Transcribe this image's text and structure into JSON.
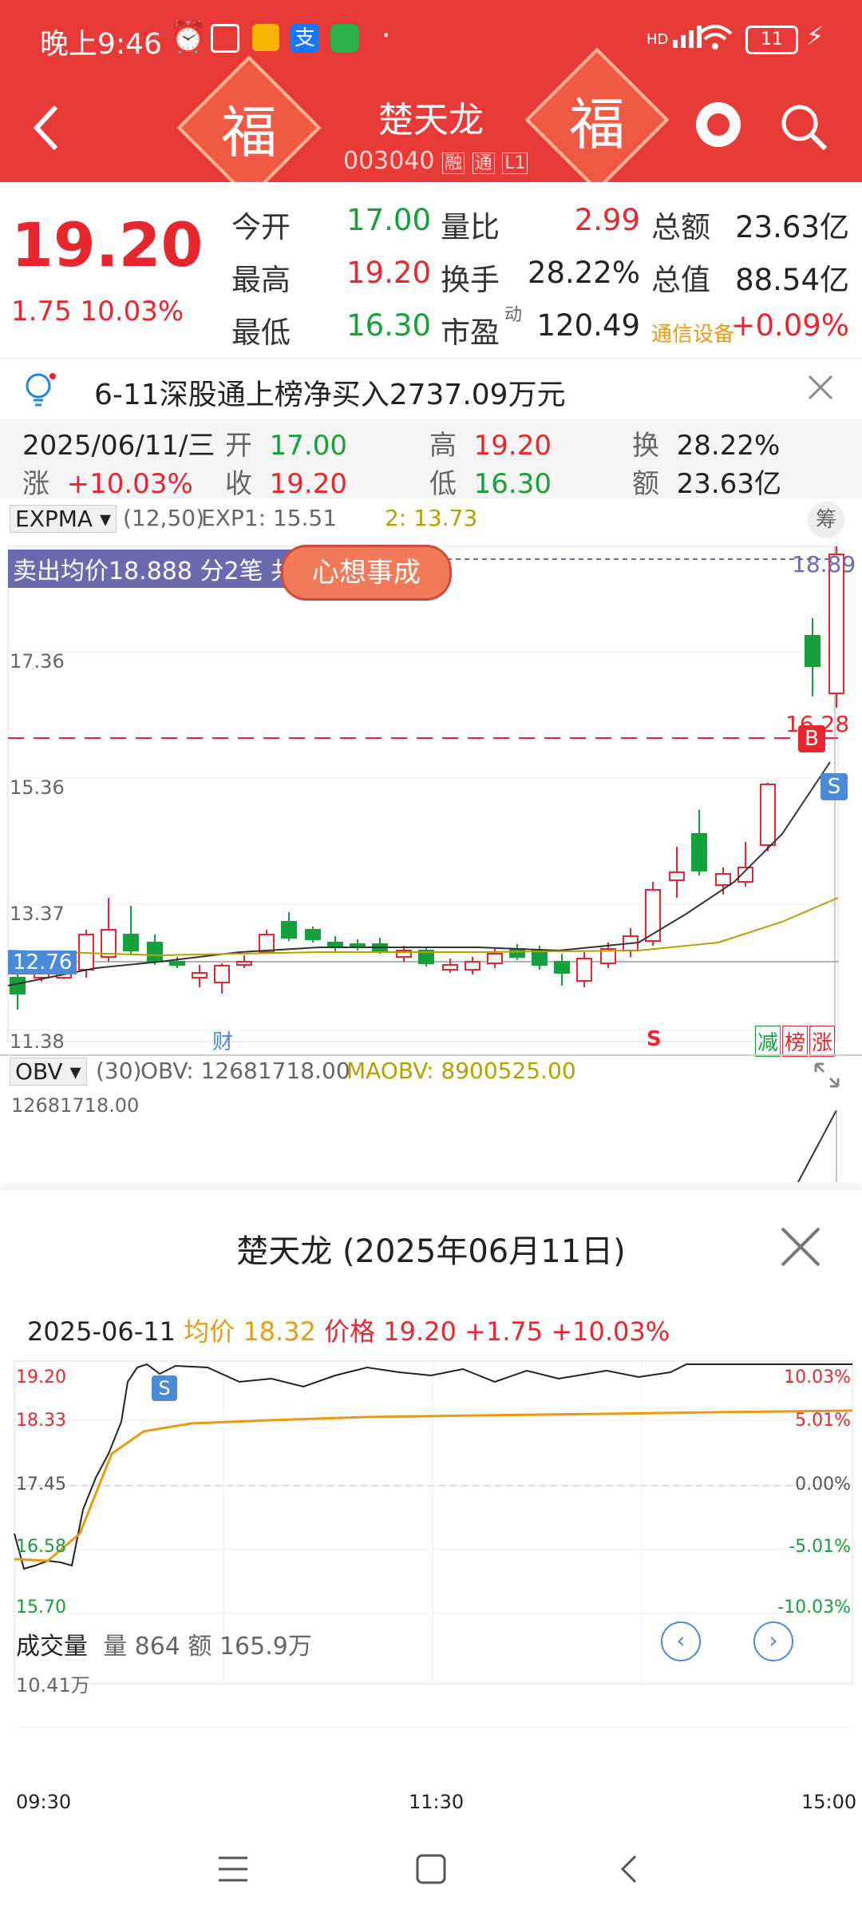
{
  "status": {
    "time": "晚上9:46",
    "battery": "11",
    "network": "HD"
  },
  "header": {
    "name": "楚天龙",
    "code": "003040",
    "tag_rong": "融",
    "tag_tong": "通",
    "tag_level": "L1",
    "fu_char": "福"
  },
  "quote": {
    "price": "19.20",
    "change": "1.75",
    "change_pct": "10.03%",
    "rows": [
      [
        {
          "l": "今开",
          "v": "17.00",
          "c": "green"
        },
        {
          "l": "量比",
          "v": "2.99",
          "c": "red"
        },
        {
          "l": "总额",
          "v": "23.63亿",
          "c": "dark"
        }
      ],
      [
        {
          "l": "最高",
          "v": "19.20",
          "c": "red"
        },
        {
          "l": "换手",
          "v": "28.22%",
          "c": "dark"
        },
        {
          "l": "总值",
          "v": "88.54亿",
          "c": "dark"
        }
      ],
      [
        {
          "l": "最低",
          "v": "16.30",
          "c": "green"
        },
        {
          "l": "市盈",
          "sup": "动",
          "v": "120.49",
          "c": "dark"
        },
        {
          "l": "通信设备",
          "v": "+0.09%",
          "c": "red"
        }
      ]
    ]
  },
  "notice": {
    "text": "6-11深股通上榜净买入2737.09万元"
  },
  "info": {
    "date": "2025/06/11/三",
    "row1": [
      {
        "l": "开",
        "v": "17.00",
        "c": "green"
      },
      {
        "l": "高",
        "v": "19.20",
        "c": "red"
      },
      {
        "l": "换",
        "v": "28.22%",
        "c": "dark"
      }
    ],
    "row2": [
      {
        "l": "涨",
        "v": "+10.03%",
        "c": "red"
      },
      {
        "l": "收",
        "v": "19.20",
        "c": "red"
      },
      {
        "l": "低",
        "v": "16.30",
        "c": "green"
      },
      {
        "l": "额",
        "v": "23.63亿",
        "c": "dark"
      }
    ]
  },
  "kchart": {
    "indicator": "EXPMA",
    "params": "(12,50)",
    "exp1": "EXP1: 15.51",
    "exp2": "2: 13.73",
    "chou": "筹",
    "sell_label": "卖出均价18.888 分2笔 共",
    "sticker": "心想事成",
    "price_labels": {
      "top": "18.89",
      "p1": "17.36",
      "p2": "15.36",
      "p3": "13.37",
      "cur": "12.76",
      "low": "11.38",
      "buy": "16.28"
    },
    "markers": {
      "b": "B",
      "s": "S",
      "cai": "财",
      "s_red": "S",
      "jian": "减",
      "bang": "榜",
      "zhang": "涨"
    }
  },
  "obv": {
    "indicator": "OBV",
    "params": "(30)",
    "obv": "OBV: 12681718.00",
    "maobv": "MAOBV: 8900525.00",
    "top": "12681718.00"
  },
  "popup": {
    "title": "楚天龙 (2025年06月11日)",
    "date": "2025-06-11",
    "avg_label": "均价 18.32",
    "price_label": "价格 19.20",
    "chg": "+1.75",
    "pct": "+10.03%",
    "left_labels": [
      "19.20",
      "18.33",
      "17.45",
      "16.58",
      "15.70"
    ],
    "right_labels": [
      "10.03%",
      "5.01%",
      "0.00%",
      "-5.01%",
      "-10.03%"
    ],
    "s_marker": "S",
    "vol_title": "成交量",
    "vol_amt": "量 864",
    "vol_money": "额 165.9万",
    "vol_max": "10.41万",
    "times": [
      "09:30",
      "11:30",
      "15:00"
    ]
  },
  "colors": {
    "red": "#e8262e",
    "green": "#14a03a",
    "header": "#e83a36"
  },
  "chart_data": {
    "type": "line",
    "title": "楚天龙 (2025年06月11日)",
    "x_ticks": [
      "09:30",
      "11:30",
      "15:00"
    ],
    "ylim": [
      15.7,
      19.2
    ],
    "series": [
      {
        "name": "价格",
        "last": 19.2
      },
      {
        "name": "均价",
        "last": 18.32
      }
    ]
  }
}
